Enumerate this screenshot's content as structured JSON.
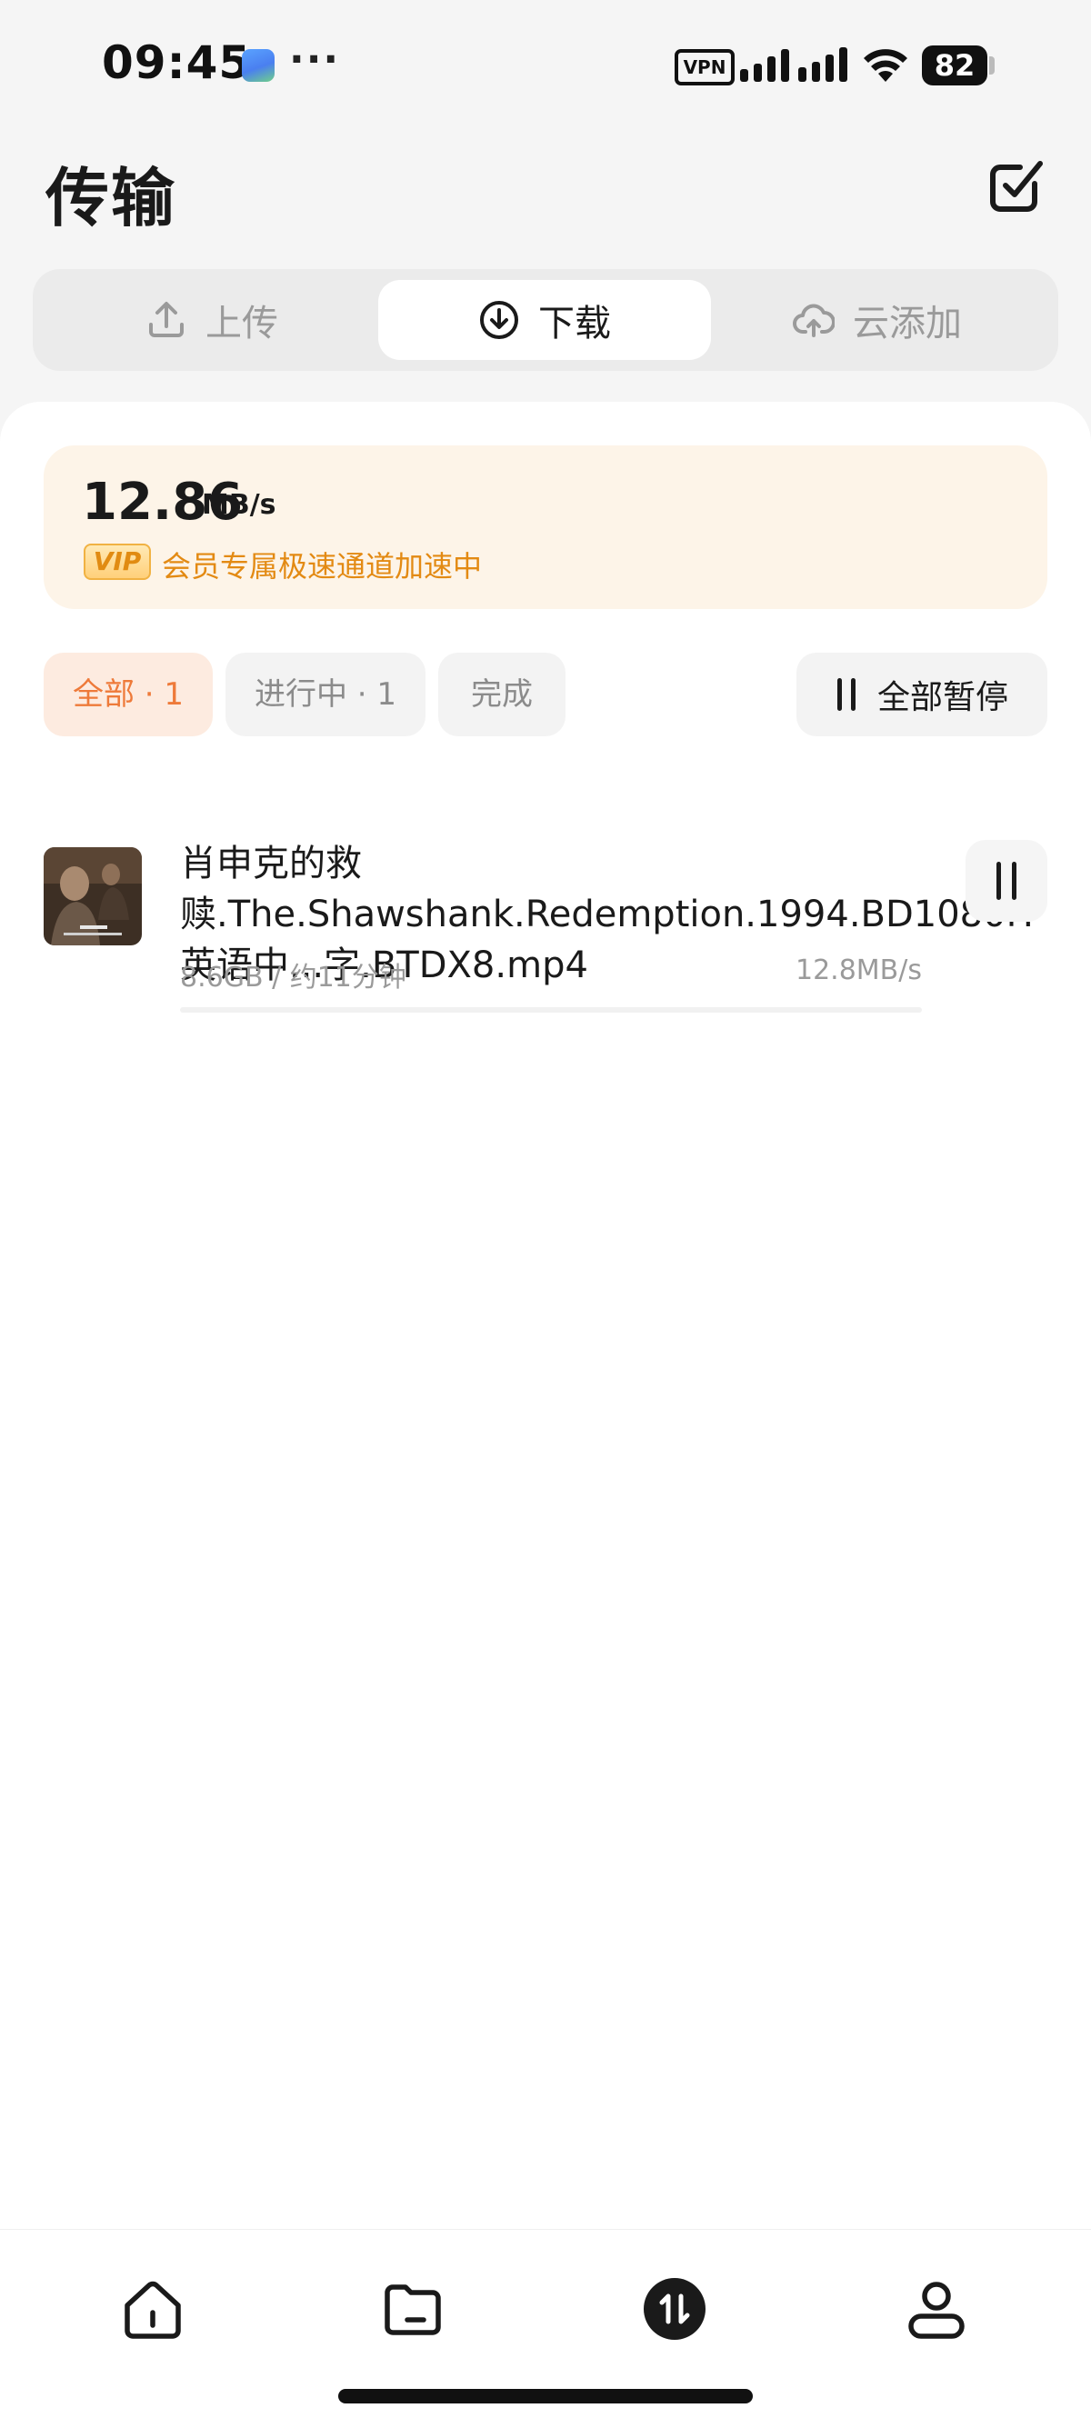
{
  "status_bar": {
    "time": "09:45",
    "dots": "···",
    "vpn": "VPN",
    "battery": "82"
  },
  "header": {
    "title": "传输"
  },
  "tabs": [
    {
      "label": "上传",
      "icon": "upload-icon",
      "active": false
    },
    {
      "label": "下载",
      "icon": "download-icon",
      "active": true
    },
    {
      "label": "云添加",
      "icon": "cloud-upload-icon",
      "active": false
    }
  ],
  "speed": {
    "value": "12.86",
    "unit": "MB/s",
    "vip_badge": "VIP",
    "vip_text": "会员专属极速通道加速中",
    "accent": "#e38a13"
  },
  "filters": [
    {
      "label": "全部 · 1",
      "active": true
    },
    {
      "label": "进行中 · 1",
      "active": false
    },
    {
      "label": "完成",
      "active": false
    }
  ],
  "pause_all_label": "全部暂停",
  "downloads": [
    {
      "name": "肖申克的救赎.The.Shawshank.Redemption.1994.BD1080P.英语中...字.BTDX8.mp4",
      "size_eta": "8.6GB / 约11分钟",
      "speed": "12.8MB/s",
      "progress": 0.0
    }
  ],
  "bottom_nav": [
    {
      "icon": "home-icon",
      "active": false
    },
    {
      "icon": "folder-icon",
      "active": false
    },
    {
      "icon": "transfer-icon",
      "active": true
    },
    {
      "icon": "profile-icon",
      "active": false
    }
  ],
  "colors": {
    "accent_orange": "#ee7a3a",
    "vip_gold": "#e38a13",
    "speed_card_bg": "#fdf4e8"
  }
}
